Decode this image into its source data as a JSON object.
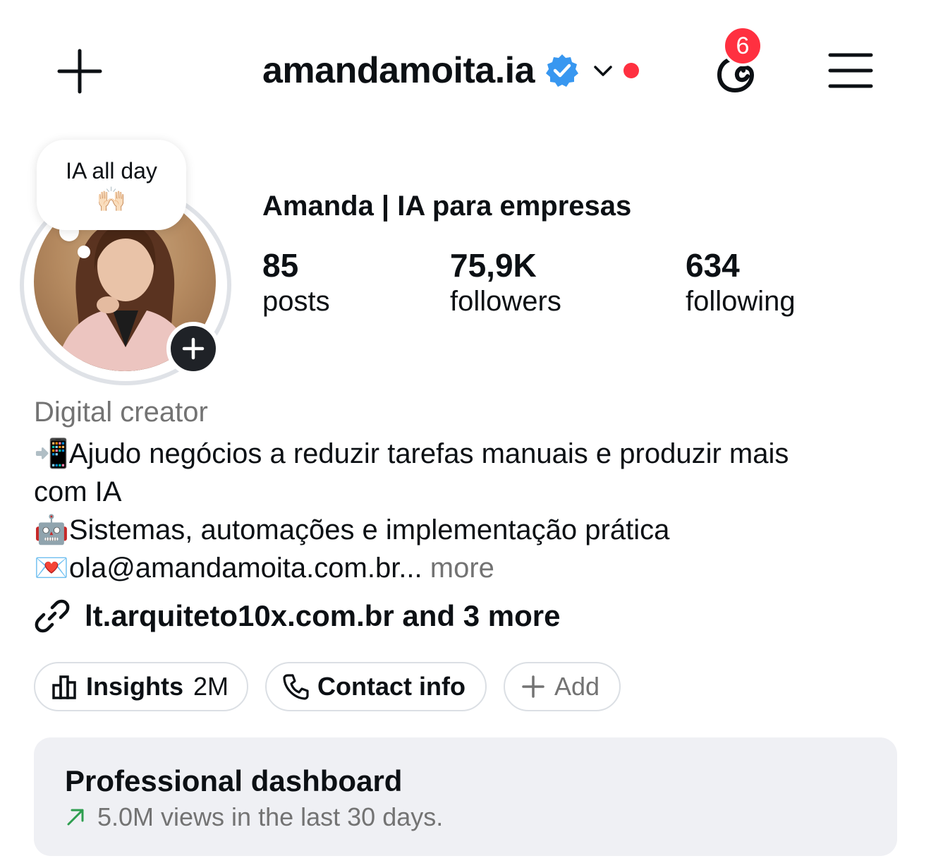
{
  "header": {
    "username": "amandamoita.ia",
    "notification_count": "6",
    "colors": {
      "verified": "#3897f0",
      "red_dot": "#ff3040",
      "badge": "#ff3040"
    }
  },
  "profile": {
    "note_text": "IA all day",
    "note_emoji": "🙌🏻",
    "display_name": "Amanda | IA para empresas",
    "stats": [
      {
        "value": "85",
        "label": "posts"
      },
      {
        "value": "75,9K",
        "label": "followers"
      },
      {
        "value": "634",
        "label": "following"
      }
    ],
    "category": "Digital creator",
    "bio": {
      "line1_emoji": "📲",
      "line1": "Ajudo negócios a reduzir tarefas manuais e produzir mais",
      "line2": "com IA",
      "line3_emoji": "🤖",
      "line3": "Sistemas, automações e implementação prática",
      "line4_emoji": "💌",
      "line4": "ola@amandamoita.com.br...",
      "more": "more"
    },
    "link": "lt.arquiteto10x.com.br and 3 more"
  },
  "actions": {
    "insights_label": "Insights",
    "insights_value": "2M",
    "contact_label": "Contact info",
    "add_label": "Add"
  },
  "dashboard": {
    "title": "Professional dashboard",
    "subtitle": "5.0M views in the last 30 days.",
    "trend_color": "#2e9e4f"
  }
}
